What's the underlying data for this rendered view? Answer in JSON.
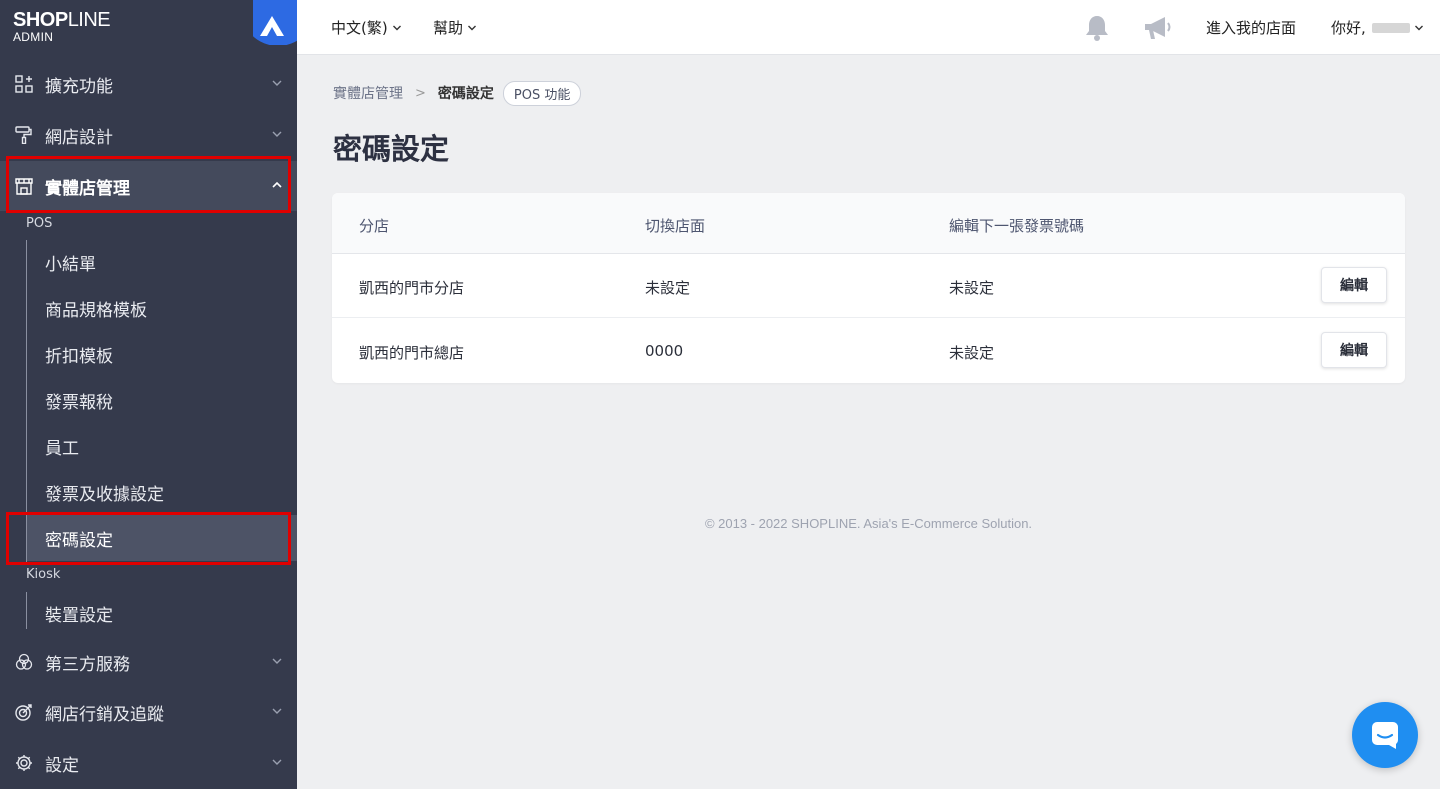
{
  "brand": {
    "logo_bold": "SHOP",
    "logo_light": "LINE",
    "sub": "ADMIN"
  },
  "sidebar": {
    "items": [
      {
        "label": "擴充功能",
        "icon": "apps-icon"
      },
      {
        "label": "網店設計",
        "icon": "paint-roller-icon"
      },
      {
        "label": "實體店管理",
        "icon": "store-icon"
      },
      {
        "label": "第三方服務",
        "icon": "circles-icon"
      },
      {
        "label": "網店行銷及追蹤",
        "icon": "target-icon"
      },
      {
        "label": "設定",
        "icon": "gear-icon"
      }
    ],
    "pos_label": "POS",
    "pos_items": [
      "小結單",
      "商品規格模板",
      "折扣模板",
      "發票報稅",
      "員工",
      "發票及收據設定",
      "密碼設定"
    ],
    "kiosk_label": "Kiosk",
    "kiosk_items": [
      "裝置設定"
    ]
  },
  "topbar": {
    "language": "中文(繁)",
    "help": "幫助",
    "enter_store": "進入我的店面",
    "greeting": "你好,"
  },
  "breadcrumb": {
    "parent": "實體店管理",
    "current": "密碼設定",
    "tag": "POS 功能"
  },
  "page": {
    "title": "密碼設定"
  },
  "table": {
    "headers": [
      "分店",
      "切換店面",
      "編輯下一張發票號碼"
    ],
    "rows": [
      {
        "branch": "凱西的門市分店",
        "switch": "未設定",
        "invoice": "未設定",
        "action": "編輯"
      },
      {
        "branch": "凱西的門市總店",
        "switch": "0000",
        "invoice": "未設定",
        "action": "編輯"
      }
    ]
  },
  "footer": {
    "text": "© 2013 - 2022 SHOPLINE. Asia's E-Commerce Solution."
  },
  "colors": {
    "sidebar": "#353a4c",
    "accent": "#1f8ef1",
    "highlight": "#e00000"
  }
}
